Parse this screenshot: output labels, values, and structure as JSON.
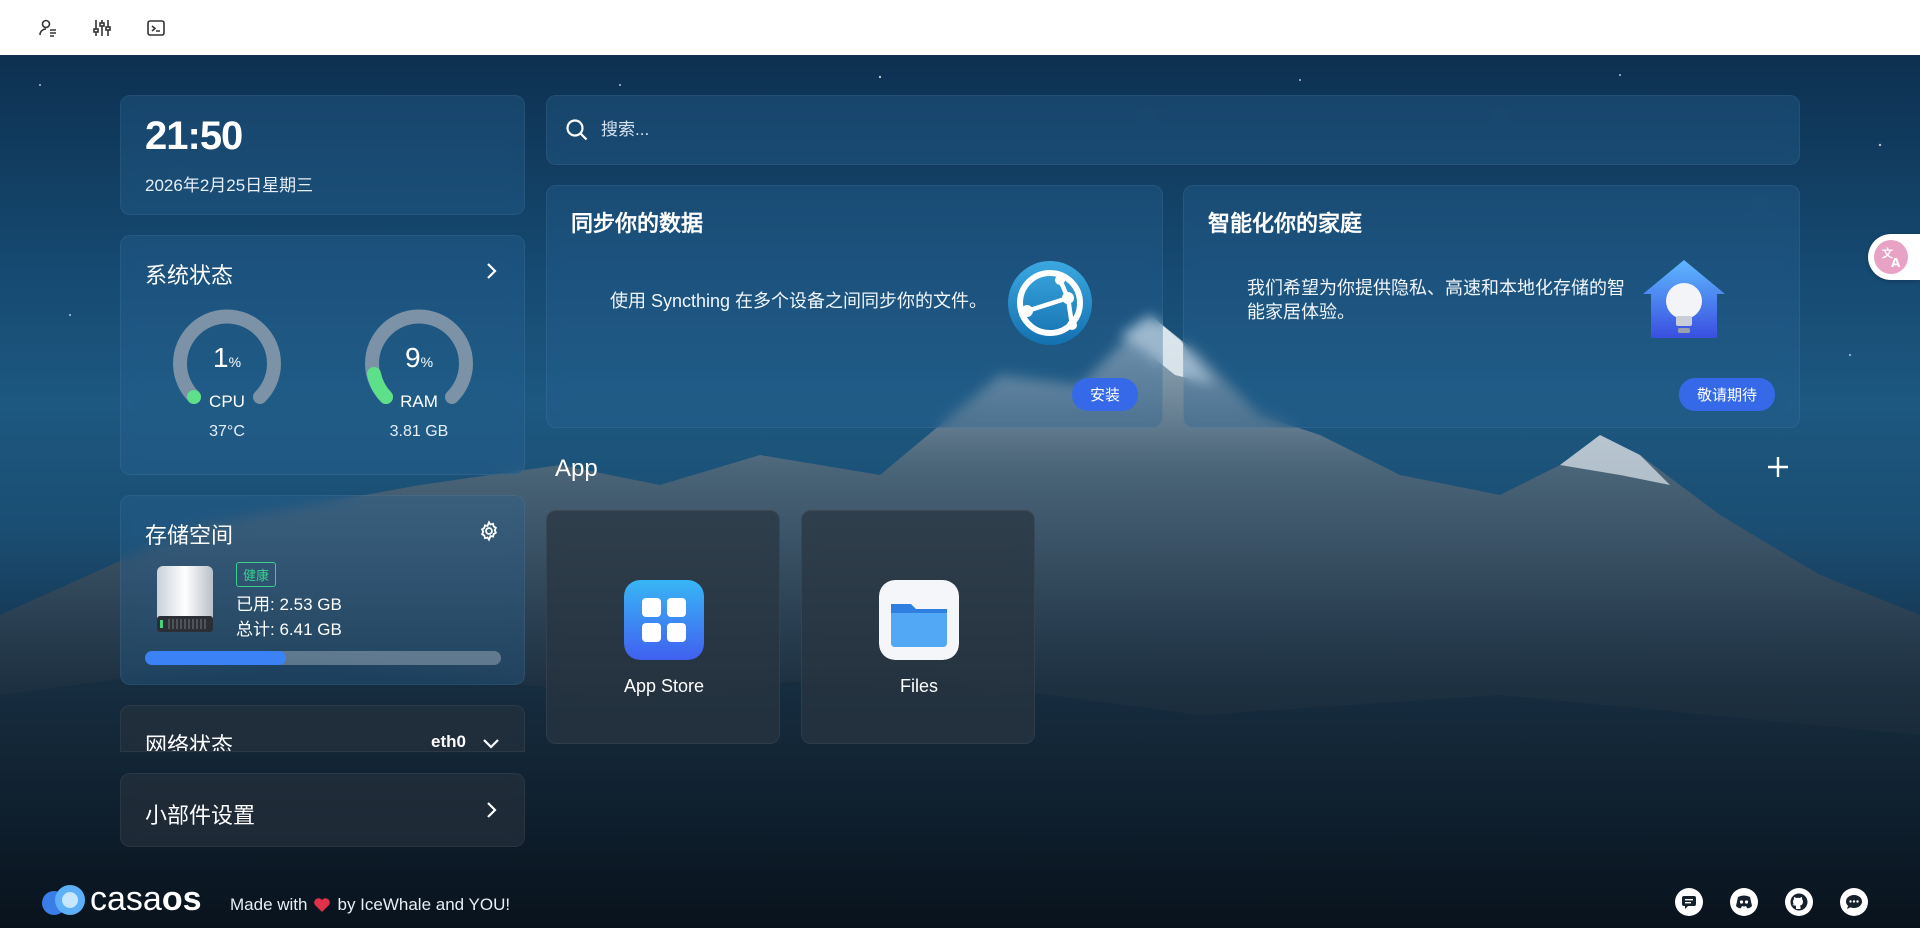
{
  "topbar": {
    "icons": [
      "account-icon",
      "sliders-icon",
      "terminal-icon"
    ]
  },
  "clock": {
    "time": "21:50",
    "date": "2026年2月25日星期三"
  },
  "system": {
    "title": "系统状态",
    "cpu": {
      "percent": "1",
      "unit": "%",
      "label": "CPU",
      "sub": "37°C",
      "value": 0.01
    },
    "ram": {
      "percent": "9",
      "unit": "%",
      "label": "RAM",
      "sub": "3.81 GB",
      "value": 0.09
    }
  },
  "storage": {
    "title": "存储空间",
    "badge": "健康",
    "used": "已用: 2.53 GB",
    "total": "总计: 6.41 GB",
    "usage_fraction": 0.395,
    "bar_color": "#3b82f6"
  },
  "network": {
    "title": "网络状态",
    "interface": "eth0"
  },
  "widgets": {
    "title": "小部件设置"
  },
  "search": {
    "placeholder": "搜索..."
  },
  "cards": {
    "sync": {
      "title": "同步你的数据",
      "description": "使用 Syncthing 在多个设备之间同步你的文件。",
      "button": "安装"
    },
    "home": {
      "title": "智能化你的家庭",
      "description": "我们希望为你提供隐私、高速和本地化存储的智能家居体验。",
      "button": "敬请期待"
    }
  },
  "apps": {
    "title": "App",
    "items": [
      {
        "name": "App Store",
        "icon": "app-store-icon"
      },
      {
        "name": "Files",
        "icon": "files-folder-icon"
      }
    ]
  },
  "footer": {
    "brand_light": "casa",
    "brand_bold": "os",
    "made_prefix": "Made with",
    "made_suffix": "by IceWhale and YOU!",
    "heart_color": "#e0304a",
    "socials": [
      "forum-icon",
      "discord-icon",
      "github-icon",
      "chat-icon"
    ]
  },
  "colors": {
    "accent": "#3569e8",
    "healthy": "#37d08f",
    "gauge_fill": "#5ee08a"
  }
}
